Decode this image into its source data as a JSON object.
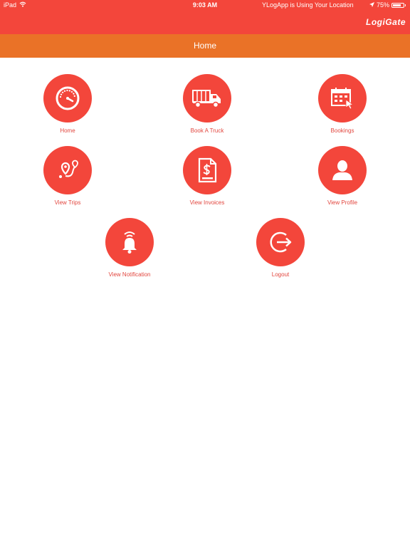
{
  "status_bar": {
    "device": "iPad",
    "time": "9:03 AM",
    "location_message": "YLogApp is Using Your Location",
    "battery": "75%",
    "battery_level": 0.75
  },
  "app": {
    "logo_text": "LogiGate",
    "page_title": "Home"
  },
  "menu": [
    {
      "label": "Home",
      "icon": "speedometer-icon"
    },
    {
      "label": "Book A Truck",
      "icon": "truck-icon"
    },
    {
      "label": "Bookings",
      "icon": "calendar-icon"
    },
    {
      "label": "View Trips",
      "icon": "route-icon"
    },
    {
      "label": "View Invoices",
      "icon": "invoice-icon"
    },
    {
      "label": "View Profile",
      "icon": "user-icon"
    },
    {
      "label": "View Notification",
      "icon": "bell-icon"
    },
    {
      "label": "Logout",
      "icon": "logout-icon"
    }
  ],
  "colors": {
    "header_red": "#f3463b",
    "title_orange": "#ea7227",
    "label_red": "#e2463e"
  }
}
